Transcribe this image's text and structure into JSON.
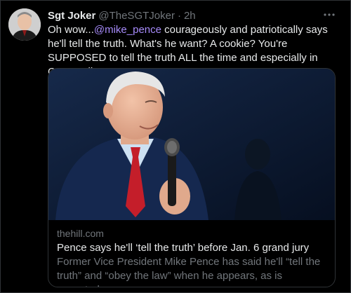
{
  "tweet": {
    "author_name": "Sgt Joker",
    "author_handle": "@TheSGTJoker",
    "separator": "·",
    "time": "2h",
    "text_before": "Oh wow...",
    "mention": "@mike_pence",
    "text_after": " courageously and patriotically says he'll tell the truth. What's he want? A cookie? You're SUPPOSED to tell the truth ALL the time and especially in Court, Mike."
  },
  "card": {
    "domain": "thehill.com",
    "title": "Pence says he'll ‘tell the truth’ before Jan. 6 grand jury",
    "description": "Former Vice President Mike Pence has said he'll “tell the truth” and “obey the law” when he appears, as is expected..."
  },
  "icons": {
    "more": "more-horizontal-icon"
  },
  "colors": {
    "background": "#000000",
    "text_primary": "#e7e9ea",
    "text_secondary": "#71767b",
    "mention": "#a78bfa",
    "border": "#2f3336"
  }
}
